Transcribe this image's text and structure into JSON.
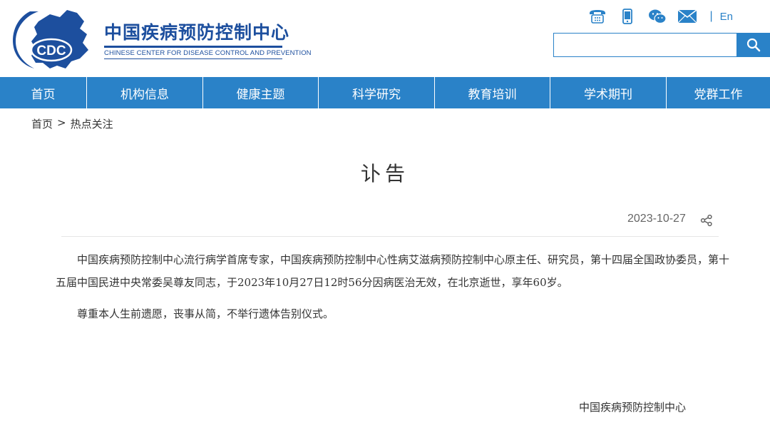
{
  "header": {
    "logo_abbr": "CDC",
    "logo_cn": "中国疾病预防控制中心",
    "logo_en": "CHINESE CENTER FOR DISEASE CONTROL AND PREVENTION",
    "lang_label": "En",
    "search": {
      "placeholder": "",
      "value": ""
    },
    "icons": [
      "phone-icon",
      "mobile-icon",
      "wechat-icon",
      "mail-icon",
      "search-icon"
    ],
    "brand_color": "#1d4f9e",
    "accent_color": "#2a82c8"
  },
  "nav": {
    "items": [
      {
        "label": "首页"
      },
      {
        "label": "机构信息"
      },
      {
        "label": "健康主题"
      },
      {
        "label": "科学研究"
      },
      {
        "label": "教育培训"
      },
      {
        "label": "学术期刊"
      },
      {
        "label": "党群工作"
      }
    ]
  },
  "breadcrumb": {
    "home": "首页",
    "separator": ">",
    "current": "热点关注"
  },
  "article": {
    "title": "讣告",
    "date": "2023-10-27",
    "paragraphs": [
      "中国疾病预防控制中心流行病学首席专家，中国疾病预防控制中心性病艾滋病预防控制中心原主任、研究员，第十四届全国政协委员，第十五届中国民进中央常委吴尊友同志，于2023年10月27日12时56分因病医治无效，在北京逝世，享年60岁。",
      "尊重本人生前遗愿，丧事从简，不举行遗体告别仪式。"
    ],
    "signature": "中国疾病预防控制中心"
  }
}
